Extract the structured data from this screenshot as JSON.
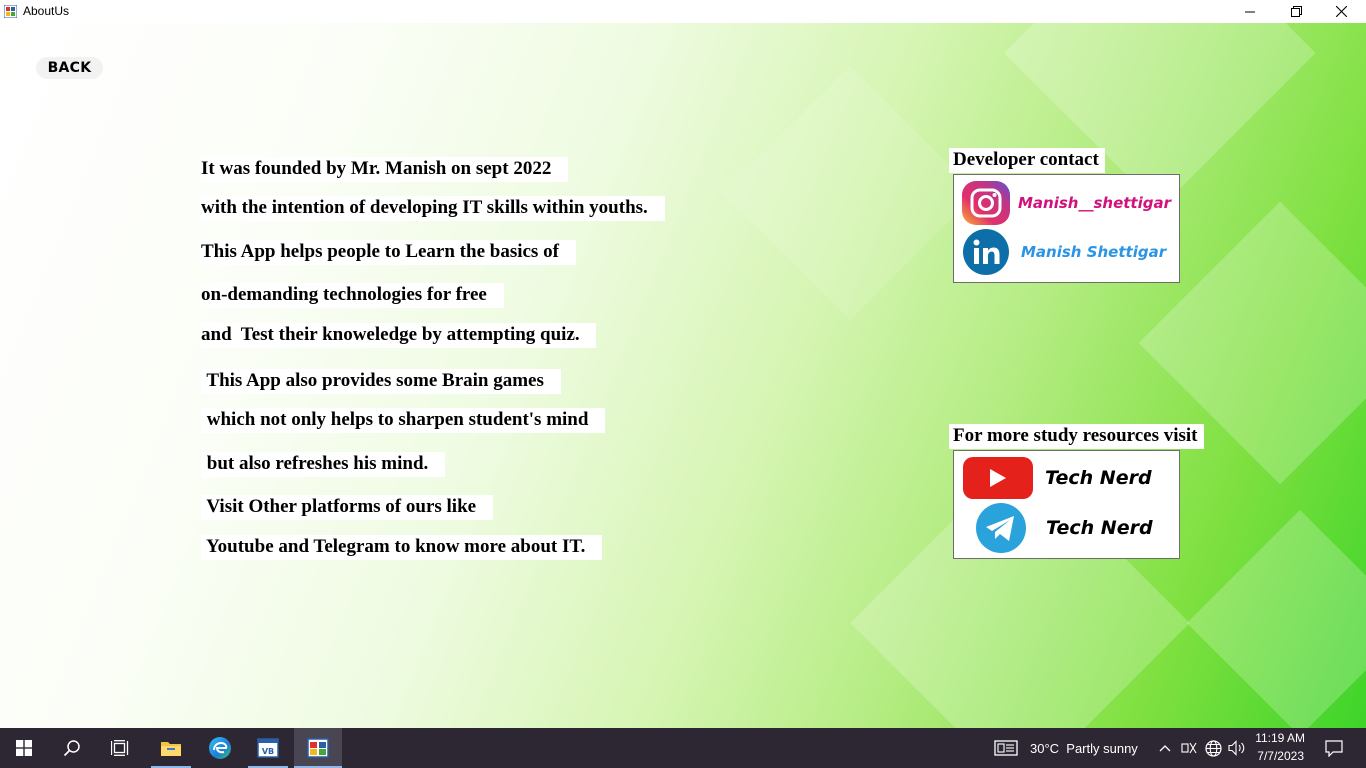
{
  "window": {
    "title": "AboutUs",
    "controls": [
      "minimize",
      "restore",
      "close"
    ]
  },
  "back_button": {
    "label": "BACK"
  },
  "about_lines": [
    "It was founded by Mr. Manish on sept 2022 ",
    "with the intention of developing IT skills within youths. ",
    "This App helps people to Learn the basics of ",
    "on-demanding technologies for free ",
    "and  Test their knoweledge by attempting quiz. ",
    " This App also provides some Brain games ",
    " which not only helps to sharpen student's mind ",
    " but also refreshes his mind. ",
    " Visit Other platforms of ours like ",
    " Youtube and Telegram to know more about IT. "
  ],
  "developer_contact": {
    "heading": "Developer contact",
    "instagram": {
      "icon": "instagram-icon",
      "label": "Manish__shettigar",
      "color": "#d1127c"
    },
    "linkedin": {
      "icon": "linkedin-icon",
      "label": "Manish Shettigar",
      "color": "#2b94e3"
    }
  },
  "study_resources": {
    "heading": "For more study resources visit",
    "youtube": {
      "icon": "youtube-icon",
      "label": "Tech Nerd"
    },
    "telegram": {
      "icon": "telegram-icon",
      "label": "Tech Nerd"
    }
  },
  "taskbar": {
    "items": [
      "start-icon",
      "search-icon",
      "task-view-icon",
      "file-explorer-icon",
      "edge-icon",
      "visual-studio-icon",
      "aboutus-app-icon"
    ],
    "weather": "30°C  Partly sunny",
    "time": "11:19 AM",
    "date": "7/7/2023"
  }
}
